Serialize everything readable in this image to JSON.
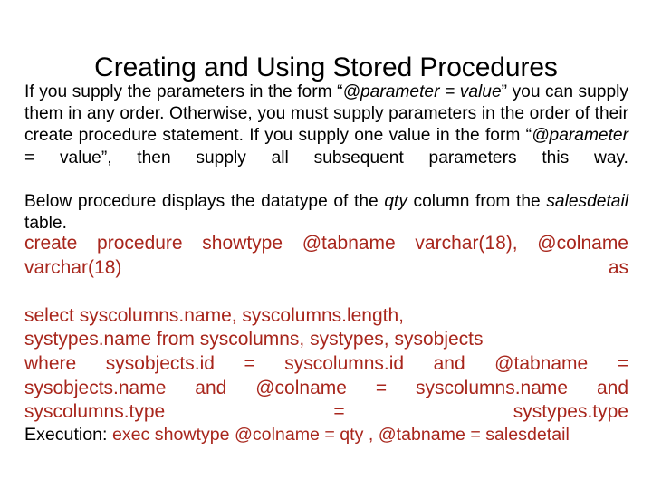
{
  "slide": {
    "title": "Creating and Using Stored Procedures",
    "accent_color": "#A8261C",
    "text_color": "#000000",
    "background_color": "#FFFFFF"
  },
  "paragraphs": [
    {
      "id": "parameter-order-paragraph",
      "runs": [
        {
          "text": "If you supply the parameters in the form “",
          "italic": false
        },
        {
          "text": "@parameter = value",
          "italic": true
        },
        {
          "text": "” you can supply them in any order. Otherwise, you must supply parameters in the order of their create procedure statement. If you supply one value in the form “",
          "italic": false
        },
        {
          "text": "@parameter",
          "italic": true
        },
        {
          "text": " = value”, then supply all subsequent parameters this way.",
          "italic": false
        }
      ]
    },
    {
      "id": "below-procedure-paragraph",
      "runs": [
        {
          "text": "Below procedure displays the datatype of the ",
          "italic": false
        },
        {
          "text": "qty",
          "italic": true
        },
        {
          "text": " column from the ",
          "italic": false
        },
        {
          "text": "salesdetail",
          "italic": true
        },
        {
          "text": " table.",
          "italic": false
        }
      ]
    }
  ],
  "code_block": {
    "lines": [
      {
        "id": "code-line-create",
        "text": "create procedure showtype @tabname varchar(18), @colname varchar(18) as",
        "align": "justify"
      },
      {
        "id": "code-line-select",
        "text": "select syscolumns.name, syscolumns.length,",
        "align": "left"
      },
      {
        "id": "code-line-from",
        "text": "systypes.name from syscolumns, systypes, sysobjects",
        "align": "left"
      },
      {
        "id": "code-line-where",
        "text": "where sysobjects.id = syscolumns.id and @tabname = sysobjects.name and @colname = syscolumns.name and syscolumns.type = systypes.type",
        "align": "justify"
      }
    ]
  },
  "execution": {
    "label": "Execution: ",
    "command": "exec showtype @colname = qty , @tabname = salesdetail"
  }
}
